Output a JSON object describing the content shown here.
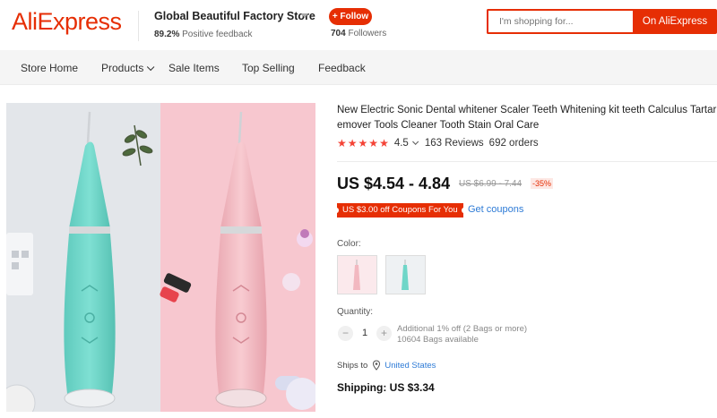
{
  "header": {
    "logo": "AliExpress",
    "store_name": "Global Beautiful Factory Store",
    "positive_feedback_value": "89.2%",
    "positive_feedback_label": "Positive feedback",
    "follow_label": "+ Follow",
    "followers_count": "704",
    "followers_label": "Followers",
    "search_placeholder": "I'm shopping for...",
    "search_button": "On AliExpress",
    "brand_color": "#e62e04"
  },
  "store_nav": {
    "items": [
      {
        "label": "Store Home"
      },
      {
        "label": "Products"
      },
      {
        "label": "Sale Items"
      },
      {
        "label": "Top Selling"
      },
      {
        "label": "Feedback"
      }
    ]
  },
  "gallery": {
    "main_image_icon": "sonic-tooth-cleaner-product-photo",
    "left_bg": "#e3e6ea",
    "right_bg": "#f7c7cf",
    "device_left_color": "#6fd6c8",
    "device_right_color": "#f2b8c0"
  },
  "product": {
    "title_line1": "New Electric Sonic Dental whitener Scaler Teeth Whitening kit teeth Calculus Tartar R",
    "title_line2": "emover Tools Cleaner Tooth Stain Oral Care",
    "rating": {
      "stars": 5,
      "value": "4.5",
      "reviews": "163 Reviews",
      "orders": "692 orders",
      "star_color": "#f44336"
    },
    "price": "US $4.54 - 4.84",
    "old_price": "US $6.99 - 7.44",
    "discount": "-35%",
    "coupon": "US $3.00 off Coupons For You",
    "get_coupons": "Get coupons",
    "color_label": "Color:",
    "color_options": [
      {
        "name": "pink",
        "color": "#f2b8c0"
      },
      {
        "name": "mint",
        "color": "#6fd6c8"
      }
    ],
    "quantity_label": "Quantity:",
    "quantity": "1",
    "qty_minus": "−",
    "qty_plus": "+",
    "qty_note_line1": "Additional 1% off (2 Bags or more)",
    "qty_note_line2": "10604 Bags available",
    "ships_to_label": "Ships to",
    "ships_to_country": "United States",
    "shipping": "Shipping: US $3.34",
    "link_color": "#2e7bd6"
  }
}
